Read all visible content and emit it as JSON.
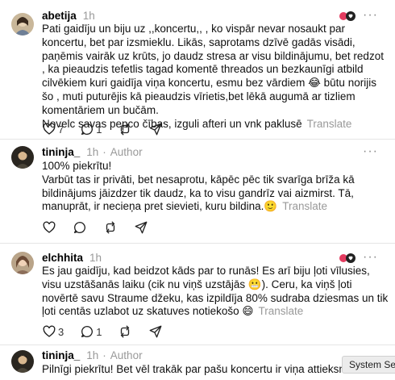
{
  "posts": [
    {
      "username": "abetija",
      "time": "1h",
      "author": "",
      "text": "Pati gaidīju un biju uz ,,koncertu,, , ko vispār nevar nosaukt par koncertu, bet par izsmieklu. Likās, saprotams dzīvē gadās visādi, paņēmis vairāk uz krūts, jo daudz stresa ar visu bildinājumu, bet redzot , ka pieaudzis tefetlis tagad komentē threados un bezkaunīgi atbild cilvēkiem kuri gaidīja viņa koncertu, esmu bez vārdiem 😂 būtu norijis šo , muti puturējis kā pieaudzis vīrietis,bet lēkā augumā ar tizliem komentāriem un bučām.",
      "text2": "Novelc savas pepco čības, izguli afteri un vnk paklusē",
      "translate": "Translate",
      "likes": "7",
      "replies": "1",
      "reposts": "",
      "more": "···"
    },
    {
      "username": "tininja_",
      "time": "1h",
      "author": "Author",
      "text": "100% piekrītu!",
      "text2": "Varbūt tas ir privāti, bet nesaprotu, kāpēc pēc tik svarīga brīža kā bildinājums jāizdzer tik daudz, ka to visu gandrīz vai aizmirst. Tā, manuprāt, ir necieņa pret sievieti, kuru bildina.🙂",
      "translate": "Translate",
      "likes": "",
      "replies": "",
      "reposts": "",
      "more": "···"
    },
    {
      "username": "elchhita",
      "time": "1h",
      "author": "",
      "text": "Es jau gaidīju, kad beidzot kāds par to runās! Es arī biju ļoti vīlusies, visu uzstāšanās laiku (cik nu viņš uzstājās 😬). Ceru, ka viņš ļoti novērtē savu Straume džeku, kas izpildīja 80% sudraba dziesmas un tik ļoti centās uzlabot uz skatuves notiekošo 😄",
      "text2": "",
      "translate": "Translate",
      "likes": "3",
      "replies": "1",
      "reposts": "",
      "more": "···"
    },
    {
      "username": "tininja_",
      "time": "1h",
      "author": "Author",
      "text": "Pilnīgi piekrītu! Bet vēl trakāk par pašu koncertu ir viņa attieksme pēc tam",
      "text2": "",
      "translate": "",
      "likes": "",
      "replies": "",
      "reposts": "",
      "more": ""
    }
  ],
  "tooltip": "System Set",
  "colors": {
    "muted": "#999999",
    "text": "#101010",
    "divider": "#e5e5e5"
  }
}
